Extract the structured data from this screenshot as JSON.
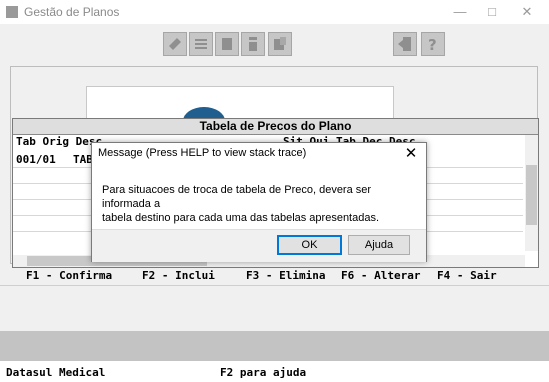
{
  "window": {
    "title": "Gestão de Planos"
  },
  "toolbar": {
    "icons": [
      "toolbar-icon-1",
      "toolbar-icon-2",
      "toolbar-icon-3",
      "toolbar-icon-4",
      "toolbar-icon-5",
      "exit-icon",
      "help-icon"
    ]
  },
  "table": {
    "title": "Tabela de Precos do Plano",
    "header_left": "Tab Orig Desc",
    "header_right": "Sit Oui Tab Dec Desc",
    "row1_code": "001/01",
    "row1_desc": "TAB"
  },
  "function_keys": [
    "F1 - Confirma",
    "F2 - Inclui",
    "F3 - Elimina",
    "F6 - Alterar",
    "F4 - Sair"
  ],
  "status": {
    "left": "Datasul Medical",
    "mid": "F2 para ajuda"
  },
  "dialog": {
    "title": "Message (Press HELP to view stack trace)",
    "message": "Para situacoes de troca de tabela de Preco,  devera ser informada a\ntabela destino para  cada uma das tabelas apresentadas.",
    "ok_label": "OK",
    "help_label": "Ajuda"
  },
  "colors": {
    "accent": "#0078d7",
    "logo": "#1f5e8e"
  }
}
